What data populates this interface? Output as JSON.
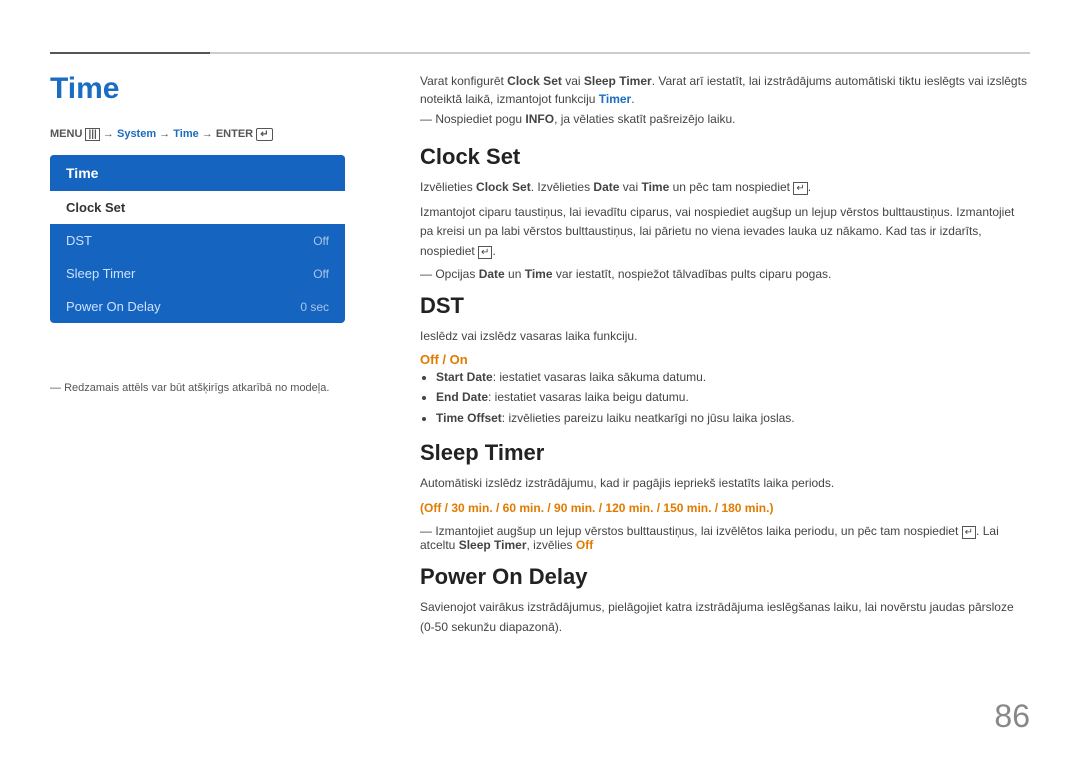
{
  "page": {
    "title": "Time",
    "page_number": "86"
  },
  "menu_path": {
    "full": "MENU  → System → Time → ENTER",
    "parts": [
      "MENU",
      "System",
      "Time",
      "ENTER"
    ]
  },
  "tv_menu": {
    "header": "Time",
    "items": [
      {
        "label": "Clock Set",
        "value": "",
        "selected": true
      },
      {
        "label": "DST",
        "value": "Off",
        "selected": false
      },
      {
        "label": "Sleep Timer",
        "value": "Off",
        "selected": false
      },
      {
        "label": "Power On Delay",
        "value": "0 sec",
        "selected": false
      }
    ]
  },
  "bottom_note": "Redzamais attēls var būt atšķirīgs atkarībā no modeļa.",
  "intro": {
    "line1": "Varat konfigurēt Clock Set vai Sleep Timer. Varat arī iestatīt, lai izstrādājums automātiski tiktu ieslēgts vai izslēgts noteiktā laikā, izmantojot funkciju Timer.",
    "line2": "Nospiediet pogu INFO, ja vēlaties skatīt pašreizējo laiku."
  },
  "sections": [
    {
      "id": "clock-set",
      "title": "Clock Set",
      "body1": "Izvēlieties Clock Set. Izvēlieties Date vai Time un pēc tam nospiediet  .",
      "body2": "Izmantojot ciparu taustiņus, lai ievadītu ciparus, vai nospiediet augšup un lejup vērstos bulttaustiņus. Izmantojiet pa kreisi un pa labi vērstos bulttaustiņus, lai pārietu no viena ievades lauka uz nākamo. Kad tas ir izdarīts, nospiediet  .",
      "note": "Opcijas Date un Time var iestatīt, nospiežot tālvadības pults ciparu pogas."
    },
    {
      "id": "dst",
      "title": "DST",
      "body1": "Ieslēdz vai izslēdz vasaras laika funkciju.",
      "off_on_label": "Off / On",
      "bullets": [
        "Start Date: iestatiet vasaras laika sākuma datumu.",
        "End Date: iestatiet vasaras laika beigu datumu.",
        "Time Offset: izvēlieties pareizu laiku neatkarīgi no jūsu laika joslas."
      ]
    },
    {
      "id": "sleep-timer",
      "title": "Sleep Timer",
      "body1": "Automātiski izslēdz izstrādājumu, kad ir pagājis iepriekš iestatīts laika periods.",
      "options_label": "(Off / 30 min. / 60 min. / 90 min. / 120 min. / 150 min. / 180 min.)",
      "note": "Izmantojiet augšup un lejup vērstos bulttaustiņus, lai izvēlētos laika periodu, un pēc tam nospiediet  . Lai atceltu Sleep Timer, izvēlies Off"
    },
    {
      "id": "power-on-delay",
      "title": "Power On Delay",
      "body1": "Savienojot vairākus izstrādājumus, pielāgojiet katra izstrādājuma ieslēgšanas laiku, lai novērstu jaudas pārsloze (0-50 sekunžu diapazonā)."
    }
  ]
}
